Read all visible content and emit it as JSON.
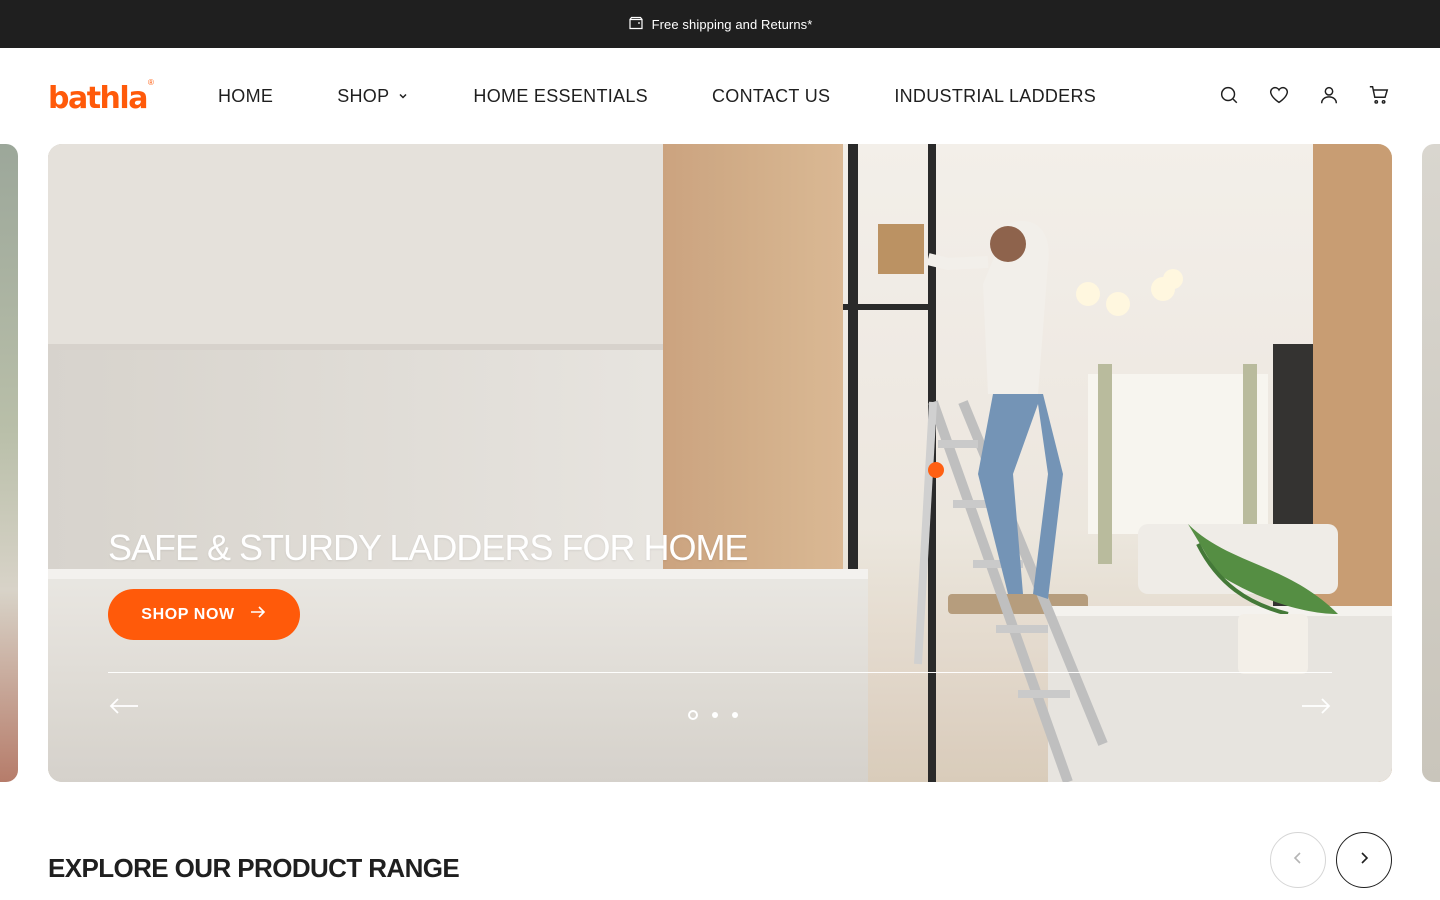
{
  "announcement": {
    "text": "Free shipping and Returns*",
    "icon": "box-icon"
  },
  "brand": {
    "logo_text": "bathla",
    "registered": "®",
    "color": "#ff5a0a"
  },
  "nav": {
    "items": [
      {
        "label": "HOME"
      },
      {
        "label": "SHOP",
        "has_dropdown": true
      },
      {
        "label": "HOME ESSENTIALS"
      },
      {
        "label": "CONTACT US"
      },
      {
        "label": "INDUSTRIAL LADDERS"
      }
    ]
  },
  "header_icons": [
    "search-icon",
    "heart-icon",
    "user-icon",
    "cart-icon"
  ],
  "hero": {
    "title": "SAFE & STURDY LADDERS FOR HOME",
    "cta_label": "SHOP NOW",
    "cta_color": "#ff5a0a",
    "slides_total": 3,
    "active_slide": 1
  },
  "product_range": {
    "title": "EXPLORE OUR PRODUCT RANGE"
  },
  "colors": {
    "topbar": "#1f1f1f",
    "accent": "#ff5a0a",
    "text": "#1f1f1f"
  }
}
